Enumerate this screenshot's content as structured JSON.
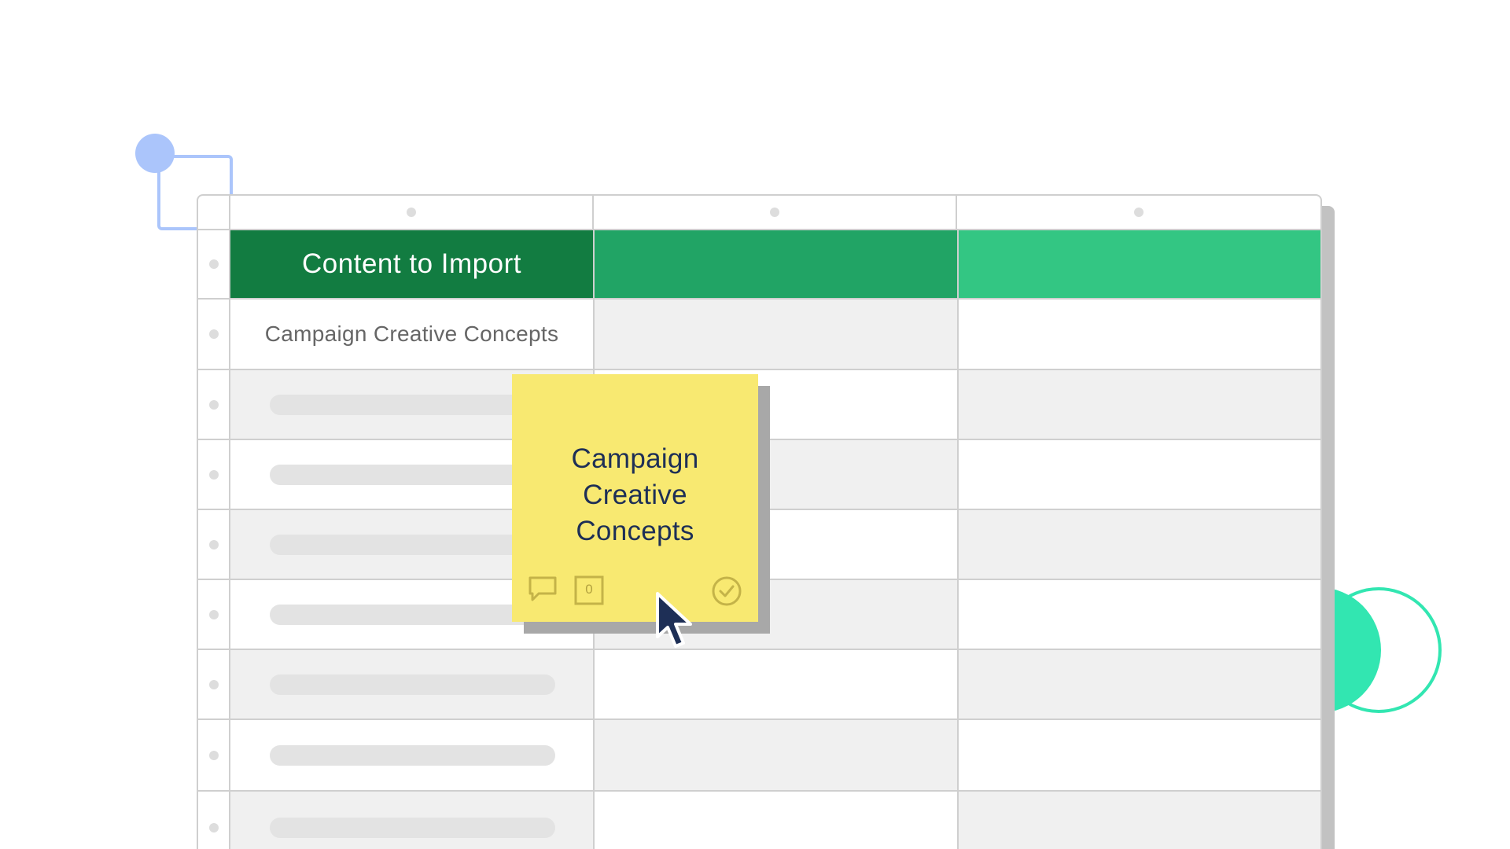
{
  "sheet": {
    "header": {
      "col1": "Content to Import",
      "col2": "",
      "col3": ""
    },
    "row1": {
      "col1": "Campaign Creative Concepts"
    }
  },
  "sticky_note": {
    "title": "Campaign\nCreative\nConcepts",
    "attachment_count": "0",
    "icons": [
      "comment-icon",
      "attachment-count-icon",
      "check-circle-icon"
    ]
  },
  "colors": {
    "header_dark_green": "#127c41",
    "header_mid_green": "#21a465",
    "header_light_green": "#33c683",
    "sticky_yellow": "#f8e971",
    "text_navy": "#1e2f56",
    "accent_blue": "#abc5fb",
    "accent_mint": "#32e6b1"
  }
}
